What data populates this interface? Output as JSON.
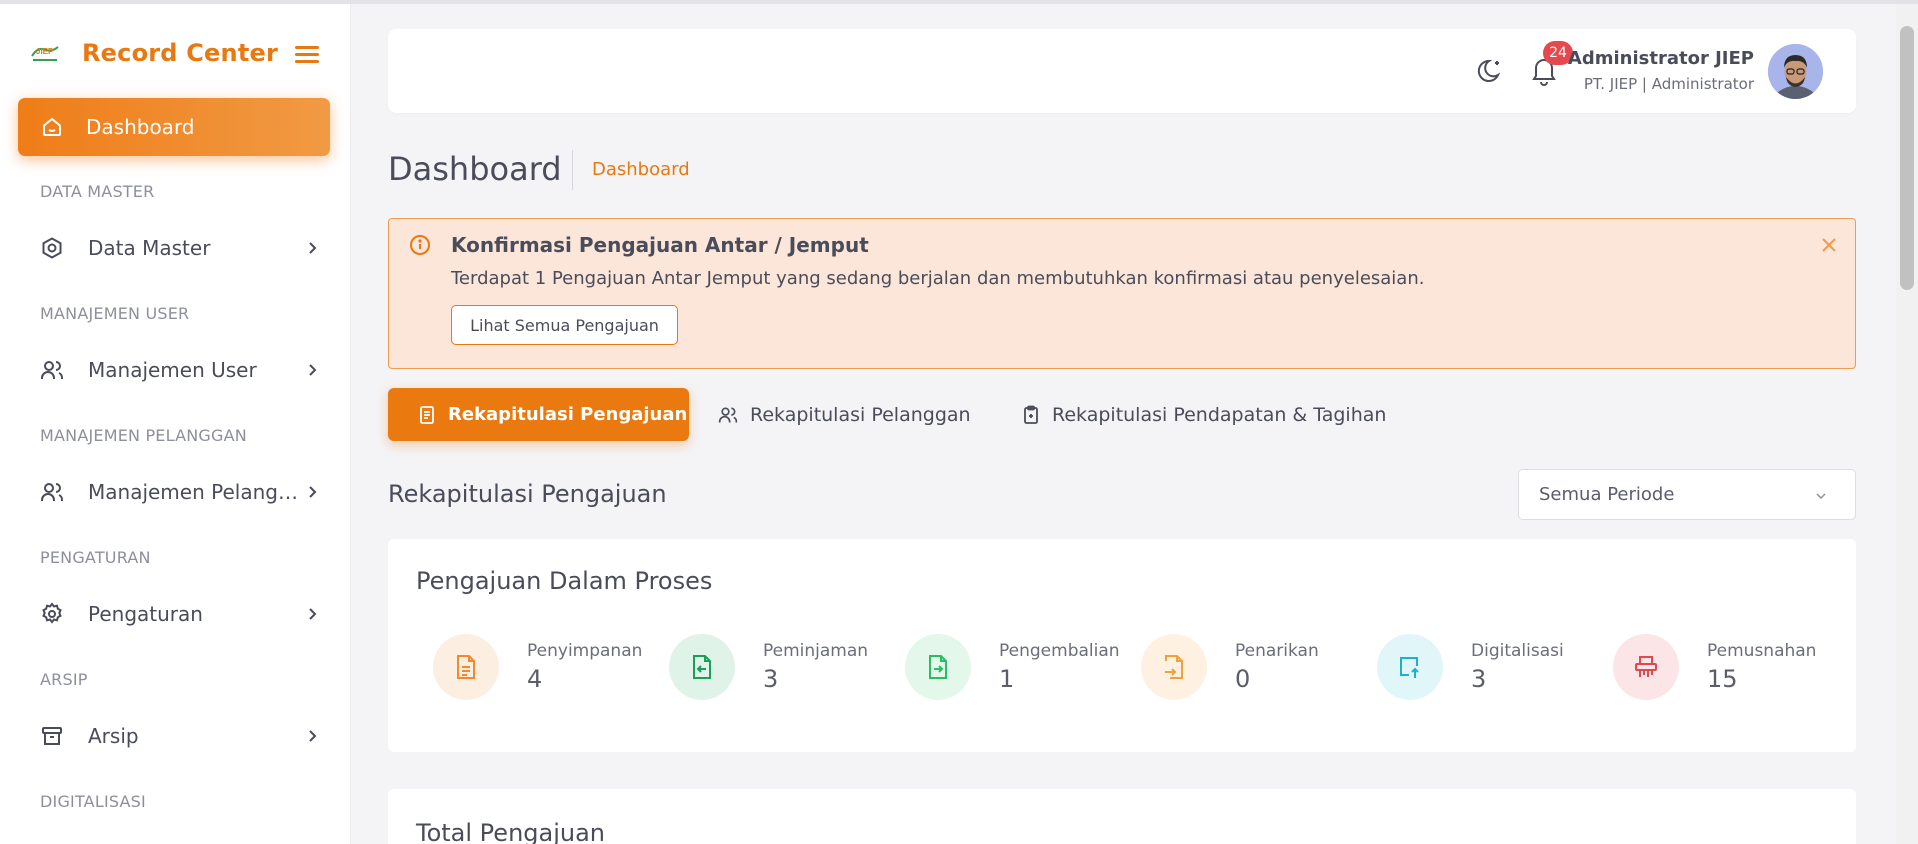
{
  "app": {
    "title": "Record Center"
  },
  "sidebar": {
    "active_item": {
      "label": "Dashboard",
      "icon": "home-icon"
    },
    "sections": [
      {
        "label": "DATA MASTER",
        "item": {
          "label": "Data Master",
          "icon": "hexagon-icon"
        }
      },
      {
        "label": "MANAJEMEN USER",
        "item": {
          "label": "Manajemen User",
          "icon": "users-icon"
        }
      },
      {
        "label": "MANAJEMEN PELANGGAN",
        "item": {
          "label": "Manajemen Pelanggan",
          "icon": "users-icon"
        }
      },
      {
        "label": "PENGATURAN",
        "item": {
          "label": "Pengaturan",
          "icon": "gear-icon"
        }
      },
      {
        "label": "ARSIP",
        "item": {
          "label": "Arsip",
          "icon": "archive-icon"
        }
      },
      {
        "label": "DIGITALISASI"
      }
    ]
  },
  "header": {
    "notification_count": "24",
    "user_name": "Administrator JIEP",
    "user_role": "PT. JIEP | Administrator"
  },
  "page": {
    "title": "Dashboard",
    "breadcrumb": "Dashboard"
  },
  "alert": {
    "title": "Konfirmasi Pengajuan Antar / Jemput",
    "text": "Terdapat 1 Pengajuan Antar Jemput yang sedang berjalan dan membutuhkan konfirmasi atau penyelesaian.",
    "button": "Lihat Semua Pengajuan"
  },
  "tabs": [
    {
      "label": "Rekapitulasi Pengajuan",
      "active": true
    },
    {
      "label": "Rekapitulasi Pelanggan",
      "active": false
    },
    {
      "label": "Rekapitulasi Pendapatan & Tagihan",
      "active": false
    }
  ],
  "section": {
    "title": "Rekapitulasi Pengajuan",
    "period_select": "Semua Periode"
  },
  "in_process": {
    "title": "Pengajuan Dalam Proses",
    "stats": [
      {
        "label": "Penyimpanan",
        "value": "4",
        "color": "#ef8a2e",
        "bg": "#fdeee2"
      },
      {
        "label": "Peminjaman",
        "value": "3",
        "color": "#1a9e58",
        "bg": "#dff3e8"
      },
      {
        "label": "Pengembalian",
        "value": "1",
        "color": "#2cbc63",
        "bg": "#e3f7ea"
      },
      {
        "label": "Penarikan",
        "value": "0",
        "color": "#f0a13a",
        "bg": "#fef1e2"
      },
      {
        "label": "Digitalisasi",
        "value": "3",
        "color": "#1bb3c9",
        "bg": "#e0f6f9"
      },
      {
        "label": "Pemusnahan",
        "value": "15",
        "color": "#e0484e",
        "bg": "#fbe5e6"
      }
    ]
  },
  "total": {
    "title": "Total Pengajuan"
  },
  "colors": {
    "accent": "#e8780f",
    "alert_bg": "#fbe6d9"
  }
}
